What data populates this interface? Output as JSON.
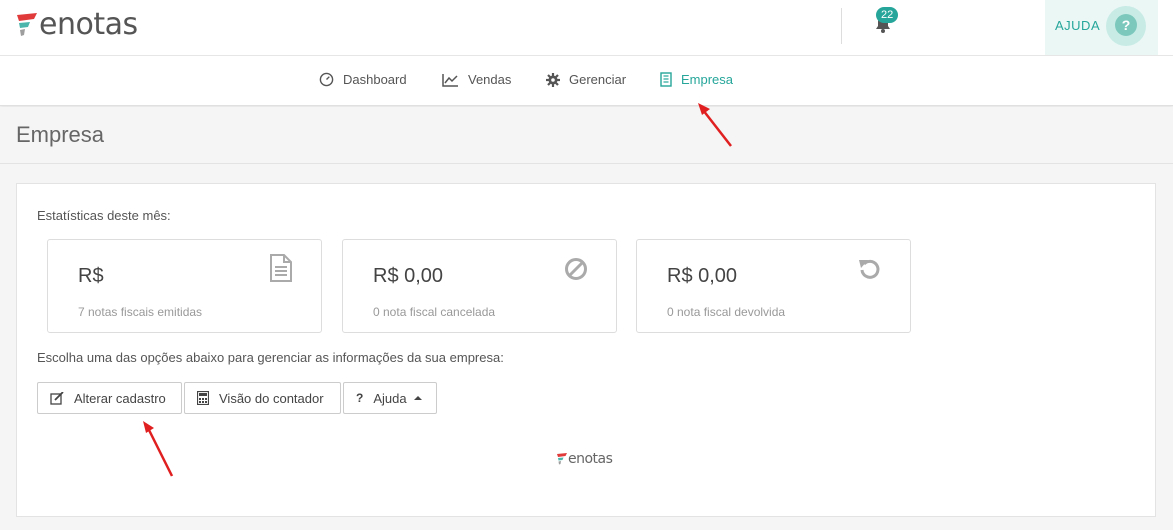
{
  "brand": {
    "name": "enotas"
  },
  "header": {
    "notification_count": "22",
    "help_label": "AJUDA",
    "help_symbol": "?"
  },
  "nav": {
    "items": [
      {
        "label": "Dashboard",
        "icon": "gauge-icon"
      },
      {
        "label": "Vendas",
        "icon": "chart-line-icon"
      },
      {
        "label": "Gerenciar",
        "icon": "gear-icon"
      },
      {
        "label": "Empresa",
        "icon": "building-icon",
        "active": true
      }
    ]
  },
  "page": {
    "title": "Empresa"
  },
  "stats": {
    "label": "Estatísticas deste mês:",
    "cards": [
      {
        "value": "R$",
        "desc": "7 notas fiscais emitidas",
        "icon": "document-icon"
      },
      {
        "value": "R$ 0,00",
        "desc": "0 nota fiscal cancelada",
        "icon": "ban-icon"
      },
      {
        "value": "R$ 0,00",
        "desc": "0 nota fiscal devolvida",
        "icon": "undo-icon"
      }
    ]
  },
  "actions": {
    "label": "Escolha uma das opções abaixo para gerenciar as informações da sua empresa:",
    "edit_label": "Alterar cadastro",
    "accountant_label": "Visão do contador",
    "help_symbol": "?",
    "help_label": "Ajuda"
  },
  "colors": {
    "accent": "#26a69a",
    "logo_red": "#e03a3a",
    "logo_green": "#4db6ac",
    "arrow": "#e02020"
  }
}
